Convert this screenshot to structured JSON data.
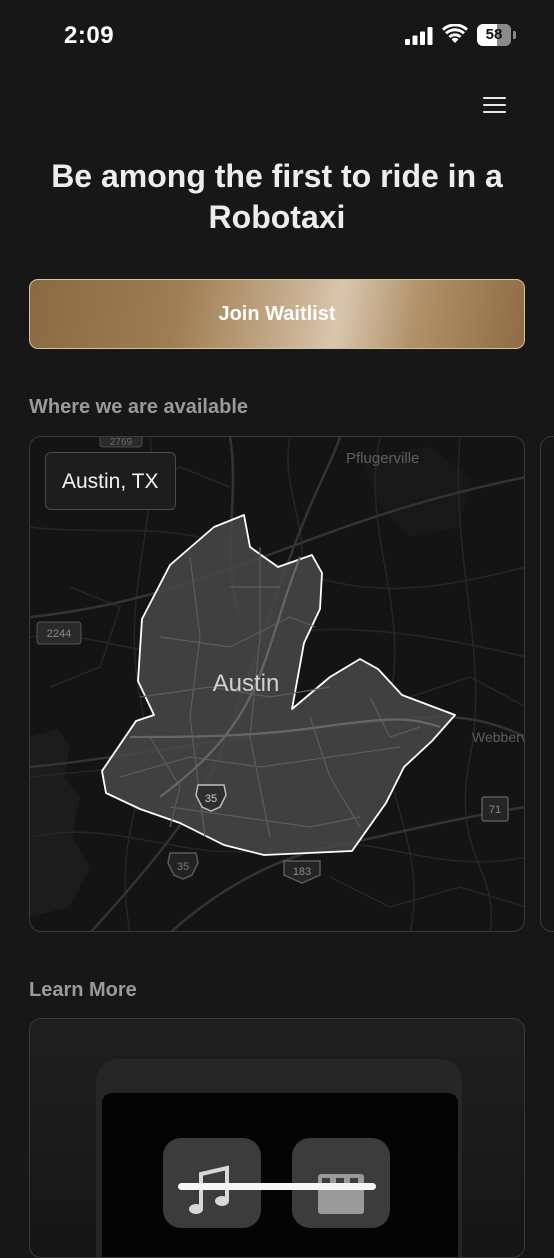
{
  "status_bar": {
    "time": "2:09",
    "battery_level": "58",
    "battery_fraction": 0.58
  },
  "header": {
    "menu_icon": "hamburger-menu-icon"
  },
  "hero": {
    "title": "Be among the first to ride in a Robotaxi",
    "join_button_label": "Join Waitlist"
  },
  "availability": {
    "section_label": "Where we are available",
    "cards": [
      {
        "city_chip": "Austin, TX",
        "map_labels": {
          "city": "Austin",
          "pflugerville": "Pflugerville",
          "webberville": "Webberv",
          "road_2769": "2769",
          "road_2244": "2244",
          "road_35_north": "35",
          "road_35_south": "35",
          "road_183": "183",
          "road_71": "71"
        }
      }
    ]
  },
  "learn_more": {
    "section_label": "Learn More",
    "icons": [
      "music-icon",
      "video-icon"
    ]
  },
  "colors": {
    "background": "#171717",
    "accent_gold": "#a88a62",
    "service_area_fill": "#4a4a4a",
    "service_area_stroke": "#ffffff"
  }
}
